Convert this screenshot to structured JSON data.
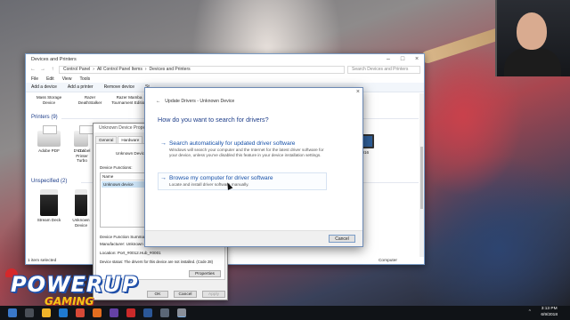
{
  "explorer": {
    "title": "Devices and Printers",
    "breadcrumb": [
      "Control Panel",
      "All Control Panel Items",
      "Devices and Printers"
    ],
    "search_placeholder": "Search Devices and Printers",
    "menu": [
      "File",
      "Edit",
      "View",
      "Tools"
    ],
    "commands": [
      "Add a device",
      "Add a printer",
      "Remove device",
      "St"
    ],
    "top_devices": [
      "Mass Storage Device",
      "Razer DeathStalker",
      "Razer Mamba Tournament Edition"
    ],
    "printers_group": "Printers (9)",
    "printers": [
      "Adobe PDF",
      "DY",
      "DY Label Printer Turbo"
    ],
    "right_devices": [
      "2016"
    ],
    "unspecified_group": "Unspecified (2)",
    "unspecified": [
      "Stream Deck",
      "Unknown Device"
    ],
    "status_left": "1 item selected",
    "status_right": "Computer"
  },
  "properties": {
    "title": "Unknown Device Properties",
    "tabs": [
      "General",
      "Hardware"
    ],
    "device_name": "Unknown Device",
    "functions_label": "Device Functions:",
    "list_header": "Name",
    "list_item": "Unknown device",
    "summary_label": "Device Function Summary",
    "manufacturer": "Manufacturer:   Unknown",
    "location": "Location:       Port_#0012.Hub_#0001",
    "status": "Device status:   The drivers for this device are not installed. (Code 28)",
    "properties_button": "Properties",
    "ok": "OK",
    "cancel": "Cancel",
    "apply": "Apply"
  },
  "update_dialog": {
    "title": "Update Drivers - Unknown Device",
    "question": "How do you want to search for drivers?",
    "option1_title": "Search automatically for updated driver software",
    "option1_desc": "Windows will search your computer and the Internet for the latest driver software for your device, unless you've disabled this feature in your device installation settings.",
    "option2_title": "Browse my computer for driver software",
    "option2_desc": "Locate and install driver software manually.",
    "cancel": "Cancel"
  },
  "logo": {
    "line1": "POWERUP",
    "line2": "GAMING"
  },
  "clock": {
    "time": "3:13 PM",
    "date": "6/9/2018"
  },
  "colors": {
    "accent": "#1650a8",
    "taskbar": "#101317",
    "logo_gold": "#f5c518"
  }
}
